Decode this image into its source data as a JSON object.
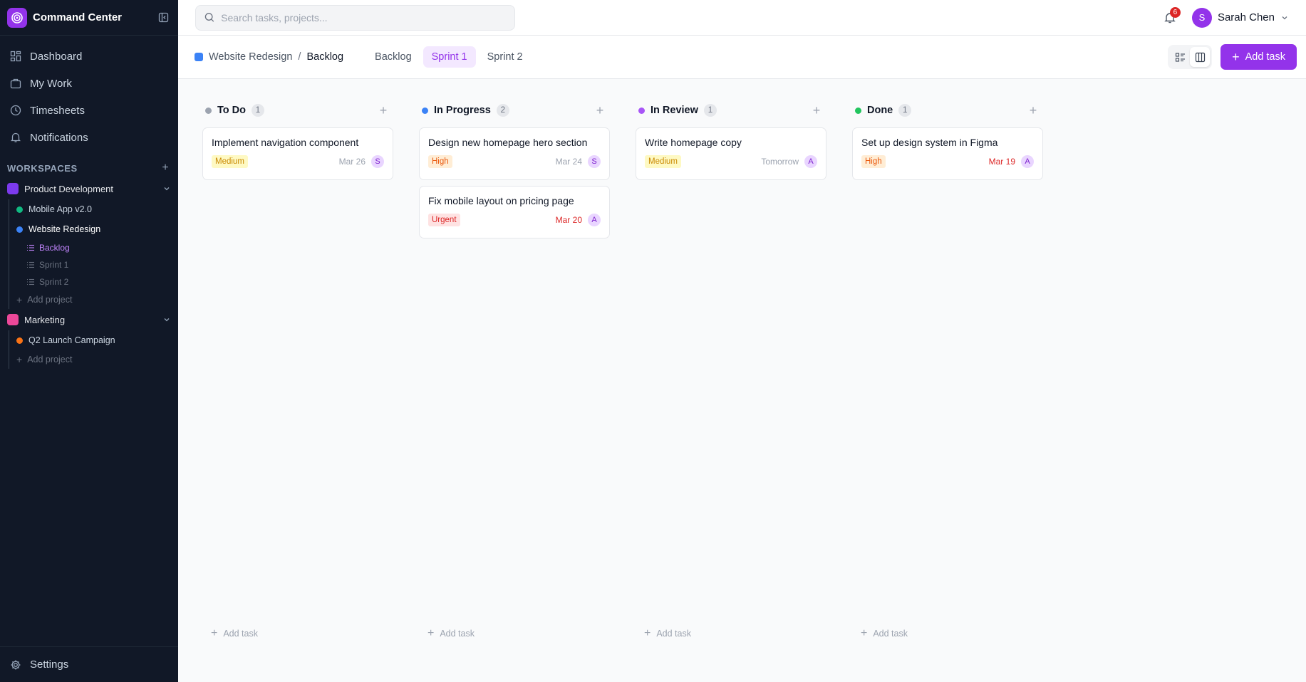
{
  "app": {
    "title": "Command Center"
  },
  "sidebar": {
    "nav": [
      {
        "label": "Dashboard"
      },
      {
        "label": "My Work"
      },
      {
        "label": "Timesheets"
      },
      {
        "label": "Notifications"
      }
    ],
    "workspaces_label": "WORKSPACES",
    "workspaces": [
      {
        "name": "Product Development",
        "color": "#7c3aed",
        "projects": [
          {
            "name": "Mobile App v2.0",
            "color": "#10b981"
          },
          {
            "name": "Website Redesign",
            "color": "#3b82f6"
          }
        ],
        "sprints": [
          "Backlog",
          "Sprint 1",
          "Sprint 2"
        ],
        "add_project_label": "Add project"
      },
      {
        "name": "Marketing",
        "color": "#ec4899",
        "projects": [
          {
            "name": "Q2 Launch Campaign",
            "color": "#f97316"
          }
        ],
        "add_project_label": "Add project"
      }
    ],
    "settings_label": "Settings"
  },
  "topbar": {
    "search_placeholder": "Search tasks, projects...",
    "notification_count": "6",
    "user": {
      "initial": "S",
      "name": "Sarah Chen"
    }
  },
  "subheader": {
    "breadcrumb": {
      "project": "Website Redesign",
      "separator": "/",
      "current": "Backlog"
    },
    "tabs": [
      "Backlog",
      "Sprint 1",
      "Sprint 2"
    ],
    "active_tab": "Sprint 1",
    "add_task_label": "Add task"
  },
  "board": {
    "columns": [
      {
        "title": "To Do",
        "color": "#9ca3af",
        "count": "1",
        "cards": [
          {
            "title": "Implement navigation component",
            "priority": "Medium",
            "date": "Mar 26",
            "assignee": "S"
          }
        ],
        "add_task_label": "Add task"
      },
      {
        "title": "In Progress",
        "color": "#3b82f6",
        "count": "2",
        "cards": [
          {
            "title": "Design new homepage hero section",
            "priority": "High",
            "date": "Mar 24",
            "assignee": "S"
          },
          {
            "title": "Fix mobile layout on pricing page",
            "priority": "Urgent",
            "date": "Mar 20",
            "assignee": "A"
          }
        ],
        "add_task_label": "Add task"
      },
      {
        "title": "In Review",
        "color": "#a855f7",
        "count": "1",
        "cards": [
          {
            "title": "Write homepage copy",
            "priority": "Medium",
            "date": "Tomorrow",
            "assignee": "A"
          }
        ],
        "add_task_label": "Add task"
      },
      {
        "title": "Done",
        "color": "#22c55e",
        "count": "1",
        "cards": [
          {
            "title": "Set up design system in Figma",
            "priority": "High",
            "date": "Mar 19",
            "assignee": "A"
          }
        ],
        "add_task_label": "Add task"
      }
    ]
  },
  "colors": {
    "accent": "#9333ea",
    "sidebar_bg": "#111827",
    "overdue": "#dc2626"
  }
}
